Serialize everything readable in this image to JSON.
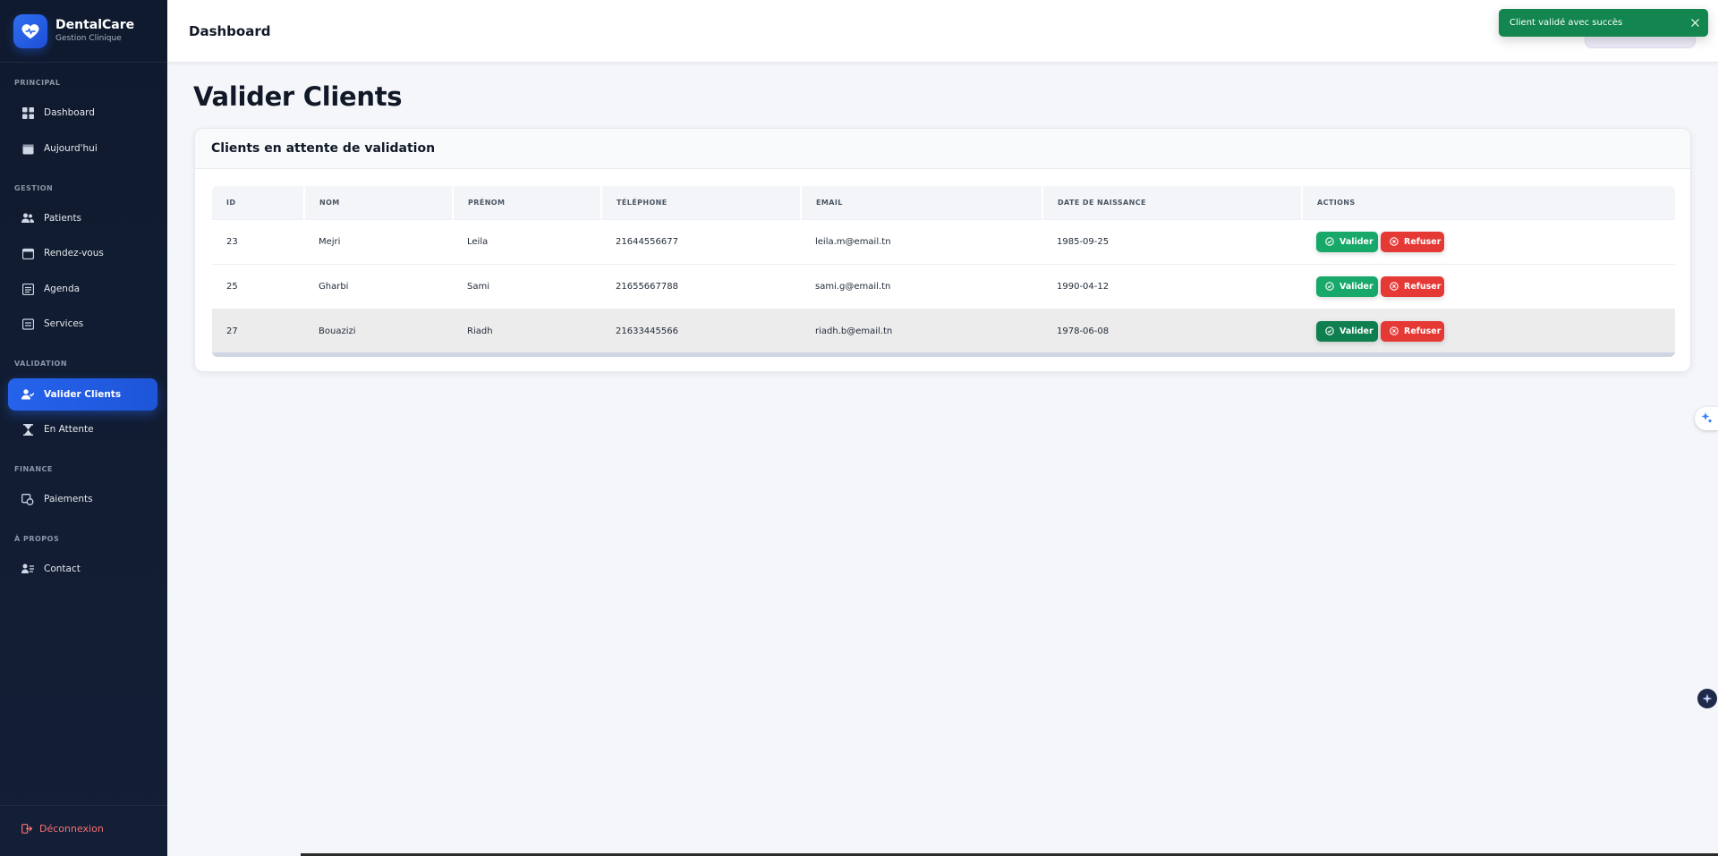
{
  "brand": {
    "name": "DentalCare",
    "subtitle": "Gestion Clinique"
  },
  "sidebar": {
    "sections": [
      {
        "label": "PRINCIPAL"
      },
      {
        "label": "GESTION"
      },
      {
        "label": "VALIDATION"
      },
      {
        "label": "FINANCE"
      },
      {
        "label": "À PROPOS"
      }
    ],
    "items": [
      {
        "label": "Dashboard",
        "icon": "grid-icon"
      },
      {
        "label": "Aujourd'hui",
        "icon": "calendar-icon"
      },
      {
        "label": "Patients",
        "icon": "users-icon"
      },
      {
        "label": "Rendez-vous",
        "icon": "calendar-check-icon"
      },
      {
        "label": "Agenda",
        "icon": "agenda-icon"
      },
      {
        "label": "Services",
        "icon": "list-icon"
      },
      {
        "label": "Valider Clients",
        "icon": "user-check-icon",
        "active": true
      },
      {
        "label": "En Attente",
        "icon": "hourglass-icon"
      },
      {
        "label": "Paiements",
        "icon": "payment-icon"
      },
      {
        "label": "Contact",
        "icon": "contact-icon"
      }
    ],
    "logout_label": "Déconnexion"
  },
  "header": {
    "title": "Dashboard"
  },
  "toast": {
    "message": "Client validé avec succès",
    "color": "#13864f"
  },
  "main": {
    "title": "Valider Clients",
    "card_title": "Clients en attente de validation",
    "table": {
      "columns": [
        "ID",
        "NOM",
        "PRÉNOM",
        "TÉLÉPHONE",
        "EMAIL",
        "DATE DE NAISSANCE",
        "ACTIONS"
      ],
      "rows": [
        [
          "23",
          "Mejri",
          "Leila",
          "21644556677",
          "leila.m@email.tn",
          "1985-09-25"
        ],
        [
          "25",
          "Gharbi",
          "Sami",
          "21655667788",
          "sami.g@email.tn",
          "1990-04-12"
        ],
        [
          "27",
          "Bouazizi",
          "Riadh",
          "21633445566",
          "riadh.b@email.tn",
          "1978-06-08"
        ]
      ]
    },
    "actions": {
      "validate_label": "Valider",
      "reject_label": "Refuser"
    }
  },
  "colors": {
    "accent": "#2563eb",
    "success": "#17a86a",
    "danger": "#e53935",
    "sidebar_bg": "#0f1a2e"
  }
}
